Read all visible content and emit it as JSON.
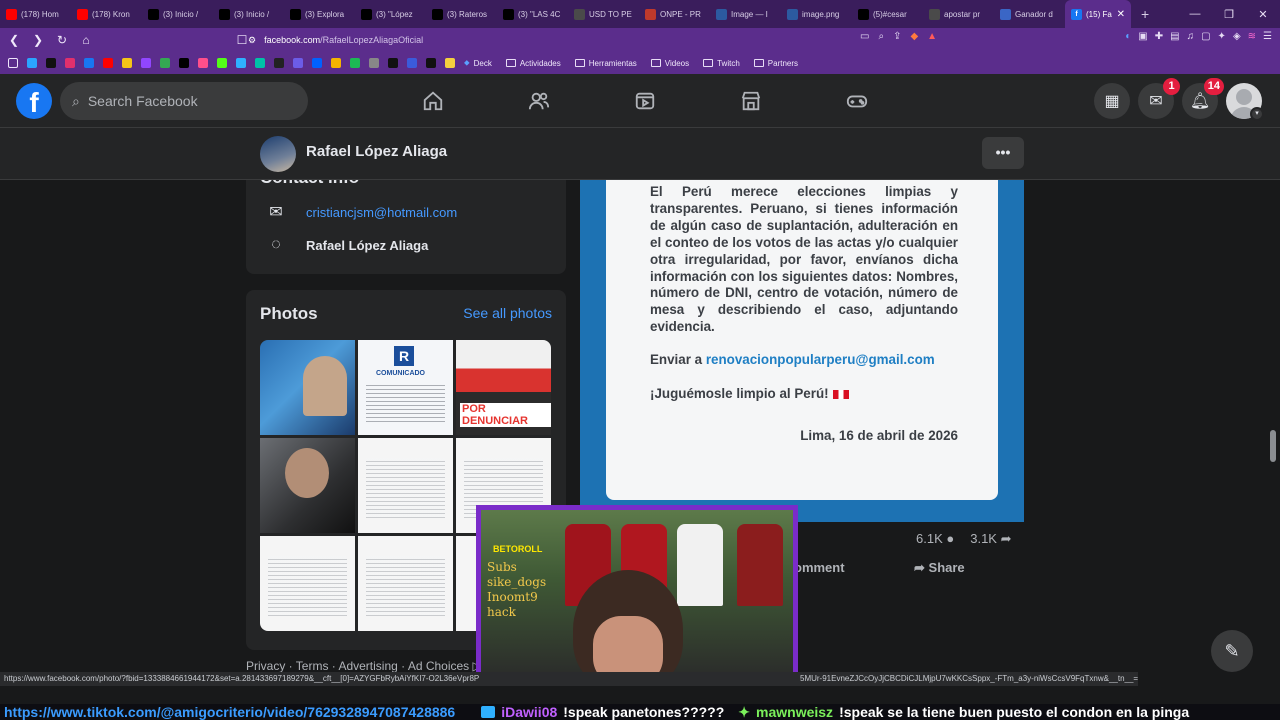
{
  "browser": {
    "tabs": [
      {
        "label": "(178) Hom",
        "color": "#ff0000"
      },
      {
        "label": "(178) Kron",
        "color": "#ff0000"
      },
      {
        "label": "(3) Inicio /",
        "color": "#000000"
      },
      {
        "label": "(3) Inicio /",
        "color": "#000000"
      },
      {
        "label": "(3) Explora",
        "color": "#000000"
      },
      {
        "label": "(3) \"López",
        "color": "#000000"
      },
      {
        "label": "(3) Rateros",
        "color": "#000000"
      },
      {
        "label": "(3) \"LAS 4C",
        "color": "#000000"
      },
      {
        "label": "USD TO PE",
        "color": "#4a4a4a"
      },
      {
        "label": "ONPE - PR",
        "color": "#c0392b"
      },
      {
        "label": "Image — I",
        "color": "#2c5aa0"
      },
      {
        "label": "image.png",
        "color": "#2c5aa0"
      },
      {
        "label": "(5)#cesar",
        "color": "#000000"
      },
      {
        "label": "apostar pr",
        "color": "#4a4a4a"
      },
      {
        "label": "Ganador d",
        "color": "#3a66c6"
      }
    ],
    "active_tab": {
      "label": "(15) Fa",
      "close": "✕"
    },
    "new_tab": "+",
    "window_controls": [
      "—",
      "❐",
      "✕"
    ],
    "url_host": "facebook.com",
    "url_path": "/RafaelLopezAliagaOficial",
    "bookmarks": {
      "folders": [
        "Deck",
        "Actividades",
        "Herramientas",
        "Videos",
        "Twitch",
        "Partners"
      ]
    }
  },
  "facebook": {
    "logo": "f",
    "search_placeholder": "Search Facebook",
    "badges": {
      "messenger": "1",
      "notifications": "14"
    }
  },
  "profile": {
    "name": "Rafael López Aliaga",
    "more": "•••"
  },
  "contact": {
    "header": "Contact info",
    "email": "cristiancjsm@hotmail.com",
    "messenger_name": "Rafael López Aliaga"
  },
  "photos": {
    "title": "Photos",
    "see_all": "See all photos",
    "comunicado": "COMUNICADO",
    "r": "R",
    "thumb3_text": "POR DENUNCIAR"
  },
  "footer": "Privacy · Terms · Advertising · Ad Choices ▷",
  "post": {
    "body": "El Perú merece elecciones limpias y transparentes. Peruano, si tienes información de algún caso de suplantación, adulteración en el conteo de los votos de las actas y/o cualquier otra irregularidad, por favor, envíanos dicha información con los siguientes datos: Nombres, número de DNI, centro de votación, número de mesa y describiendo el caso, adjuntando evidencia.",
    "send_prefix": "Enviar a ",
    "send_email": "renovacionpopularperu@gmail.com",
    "slogan": "¡Juguémosle limpio al Perú!",
    "date": "Lima, 16 de abril de 2026",
    "comments_count": "6.1K",
    "shares_count": "3.1K",
    "comment_label": "omment",
    "share_label": "Share"
  },
  "webcam": {
    "tag": "BETOROLL",
    "chalk_lines": [
      "Subs",
      "sike_dogs",
      "Inoomt9",
      "hack"
    ]
  },
  "status_url": "https://www.facebook.com/photo/?fbid=1333884661944172&set=a.281433697189279&__cft__[0]=AZYGFbRybAiYfKI7-O2L36eVpr8P",
  "status_url_tail": "5MUr-91EvneZJCcOyJjCBCDiCJLMjpU7wKKCsSppx_-FTm_a3y-niWsCcsV9FqTxnw&__tn__=EH-R",
  "ticker": {
    "link": "https://www.tiktok.com/@amigocriterio/video/7629328947087428886",
    "user1": "iDawii08",
    "msg1": "!speak panetones?????",
    "user2": "mawnweisz",
    "msg2": "!speak se la tiene buen puesto el condon en la pinga"
  }
}
